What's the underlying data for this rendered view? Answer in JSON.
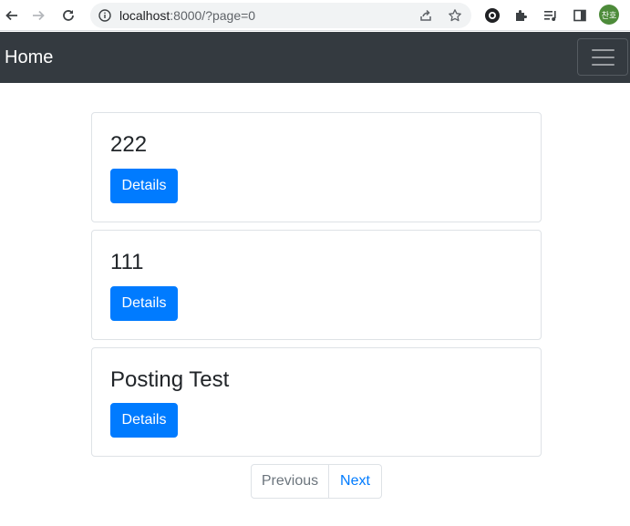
{
  "browser": {
    "url_host": "localhost",
    "url_rest": ":8000/?page=0",
    "profile_initials": "찬호"
  },
  "navbar": {
    "brand": "Home"
  },
  "posts": [
    {
      "title": "222",
      "button_label": "Details"
    },
    {
      "title": "111",
      "button_label": "Details"
    },
    {
      "title": "Posting Test",
      "button_label": "Details"
    }
  ],
  "pagination": {
    "previous_label": "Previous",
    "next_label": "Next"
  },
  "colors": {
    "navbar_bg": "#343a40",
    "primary": "#007bff",
    "disabled_text": "#6c757d"
  }
}
